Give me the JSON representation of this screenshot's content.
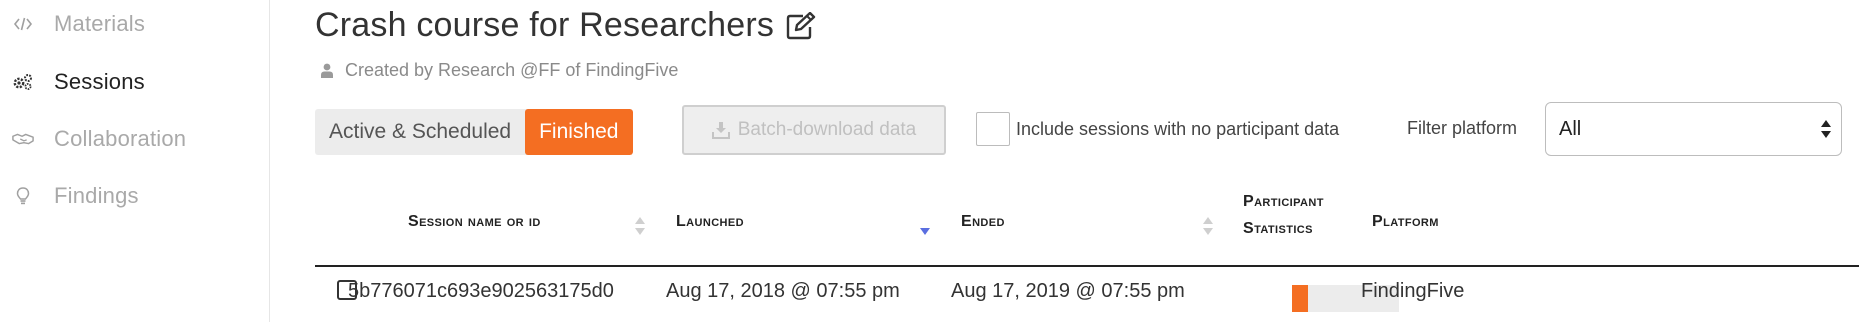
{
  "sidebar": {
    "items": [
      {
        "label": "Materials",
        "icon": "code-icon",
        "active": false
      },
      {
        "label": "Sessions",
        "icon": "gears-icon",
        "active": true
      },
      {
        "label": "Collaboration",
        "icon": "handshake-icon",
        "active": false
      },
      {
        "label": "Findings",
        "icon": "lightbulb-icon",
        "active": false
      }
    ]
  },
  "page": {
    "title": "Crash course for Researchers",
    "creator": "Created by Research @FF of FindingFive"
  },
  "toolbar": {
    "tabs": [
      {
        "label": "Active & Scheduled",
        "active": false
      },
      {
        "label": "Finished",
        "active": true
      }
    ],
    "batch_download_label": "Batch-download data",
    "include_label": "Include sessions with no participant data",
    "include_checked": false,
    "filter_label": "Filter platform",
    "filter_value": "All"
  },
  "table": {
    "columns": [
      "Session name or id",
      "Launched",
      "Ended",
      "Participant",
      "Statistics",
      "Platform"
    ],
    "sorted_by": "Launched",
    "sort_direction": "descending",
    "rows": [
      {
        "session_id": "5b776071c693e902563175d0",
        "launched": "Aug 17, 2018 @ 07:55 pm",
        "ended": "Aug 17, 2019 @ 07:55 pm",
        "participant_progress": 0.15,
        "platform": "FindingFive",
        "checked": false
      }
    ]
  },
  "colors": {
    "accent": "#f46e22",
    "sort_active": "#5a6ee0",
    "sort_inactive": "#cfcfcf",
    "muted_text": "#a9a9a9"
  }
}
